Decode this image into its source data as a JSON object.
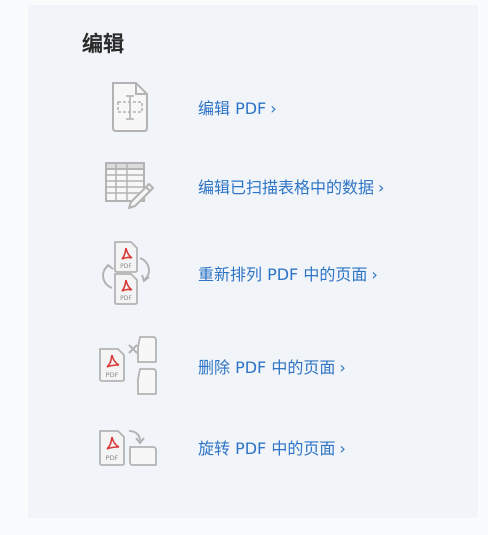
{
  "section": {
    "title": "编辑"
  },
  "items": [
    {
      "label": "编辑 PDF",
      "icon": "edit-pdf-document-icon"
    },
    {
      "label": "编辑已扫描表格中的数据",
      "icon": "spreadsheet-pencil-icon"
    },
    {
      "label": "重新排列 PDF 中的页面",
      "icon": "reorder-pdf-pages-icon"
    },
    {
      "label": "删除 PDF 中的页面",
      "icon": "delete-pdf-page-icon"
    },
    {
      "label": "旋转 PDF 中的页面",
      "icon": "rotate-pdf-page-icon"
    }
  ],
  "chevron": "›",
  "pdf_badge": "PDF",
  "colors": {
    "link": "#2e74c6",
    "icon_stroke": "#b3b3b3",
    "acrobat_red": "#d93b3b",
    "panel_bg": "#f1f5f9"
  }
}
